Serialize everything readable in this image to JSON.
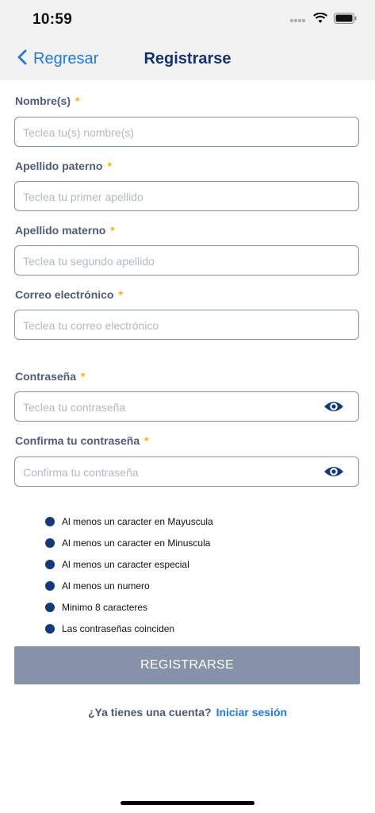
{
  "status_bar": {
    "time": "10:59"
  },
  "nav": {
    "back_label": "Regresar",
    "title": "Registrarse"
  },
  "form": {
    "required_mark": "*",
    "fields": [
      {
        "label": "Nombre(s)",
        "placeholder": "Teclea tu(s) nombre(s)",
        "value": ""
      },
      {
        "label": "Apellido paterno",
        "placeholder": "Teclea tu primer apellido",
        "value": ""
      },
      {
        "label": "Apellido materno",
        "placeholder": "Teclea tu segundo apellido",
        "value": ""
      },
      {
        "label": "Correo electrónico",
        "placeholder": "Teclea tu correo electrónico",
        "value": ""
      },
      {
        "label": "Contraseña",
        "placeholder": "Teclea tu contraseña",
        "value": ""
      },
      {
        "label": "Confirma tu contraseña",
        "placeholder": "Confirma tu contraseña",
        "value": ""
      }
    ]
  },
  "password_rules": [
    "Al menos un caracter en Mayuscula",
    "Al menos un caracter en Minuscula",
    "Al menos un caracter especial",
    "Al menos un numero",
    "Minimo 8 caracteres",
    "Las contraseñas coinciden"
  ],
  "submit_label": "REGISTRARSE",
  "login": {
    "question": "¿Ya tienes una cuenta?",
    "link": "Iniciar sesión"
  },
  "colors": {
    "accent": "#1e7ae0",
    "title": "#15336e",
    "rule_dot": "#123a7a",
    "button": "#8592a8",
    "required": "#f4b400"
  },
  "icons": {
    "back": "chevron-left-icon",
    "eye": "eye-icon",
    "wifi": "wifi-icon",
    "battery": "battery-icon",
    "signal": "signal-icon"
  }
}
